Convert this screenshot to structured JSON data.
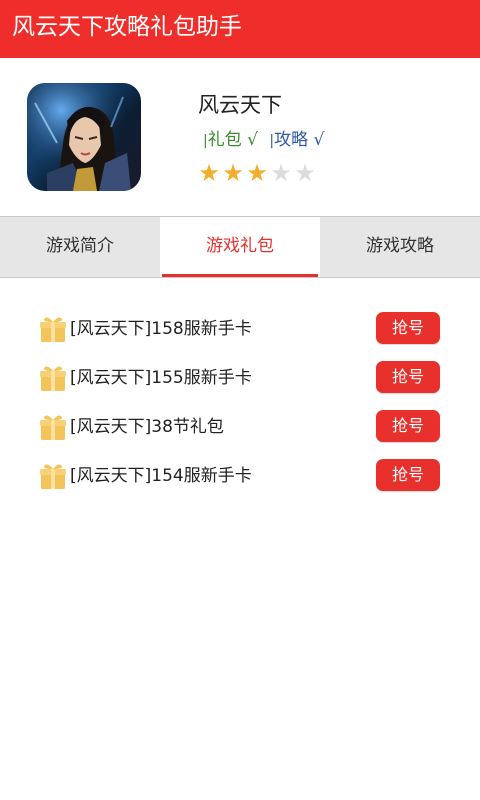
{
  "app": {
    "title": "风云天下攻略礼包助手",
    "brand_color": "#ef2e2b"
  },
  "game": {
    "name": "风云天下",
    "tags": [
      {
        "bar": "|",
        "label": "礼包 √",
        "color": "#3a8a2e"
      },
      {
        "bar": "|",
        "label": "攻略 √",
        "color": "#2f57a8"
      }
    ],
    "rating": 3,
    "rating_max": 5,
    "star_glyph": "★"
  },
  "tabs": [
    {
      "label": "游戏简介",
      "active": false
    },
    {
      "label": "游戏礼包",
      "active": true
    },
    {
      "label": "游戏攻略",
      "active": false
    }
  ],
  "gifts": [
    {
      "title": "[风云天下]158服新手卡",
      "button": "抢号"
    },
    {
      "title": "[风云天下]155服新手卡",
      "button": "抢号"
    },
    {
      "title": "[风云天下]38节礼包",
      "button": "抢号"
    },
    {
      "title": "[风云天下]154服新手卡",
      "button": "抢号"
    }
  ]
}
